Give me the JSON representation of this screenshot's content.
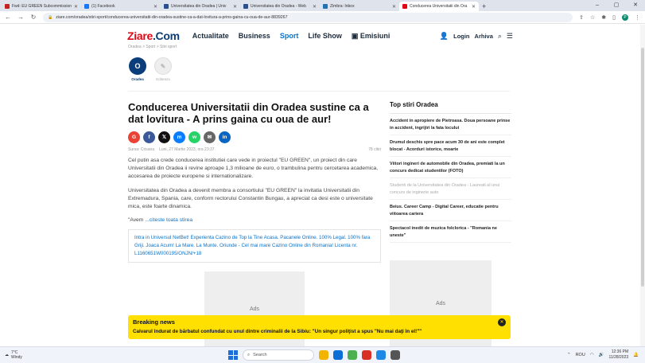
{
  "browser": {
    "tabs": [
      {
        "label": "Fwd: EU GREEN Subcommission",
        "color": "#c5221f",
        "active": false
      },
      {
        "label": "(1) Facebook",
        "color": "#1877f2",
        "active": false
      },
      {
        "label": "Universitatea din Oradea | Univ",
        "color": "#2a4f8f",
        "active": false
      },
      {
        "label": "Universitatea din Oradea - Web",
        "color": "#2a4f8f",
        "active": false
      },
      {
        "label": "Zimbra: Inbox",
        "color": "#1f73b7",
        "active": false
      },
      {
        "label": "Conducerea Universitatii din Ora",
        "color": "#e30613",
        "active": true
      }
    ],
    "new_tab_icon": "+",
    "url": "ziare.com/oradea/stiri-sport/conducerea-universitatii-din-oradea-sustine-ca-a-dat-lovitura-a-prins-gaina-cu-oua-de-aur-8839267",
    "profile_letter": "P"
  },
  "site": {
    "logo_main": "Ziare",
    "logo_suffix": ".Com",
    "nav": [
      "Actualitate",
      "Business",
      "Sport",
      "Life Show",
      "Emisiuni"
    ],
    "active_nav": "Sport",
    "login": "Login",
    "arhiva": "Arhiva",
    "breadcrumb": "Oradea  >  Sport  >  Stiri sport"
  },
  "sources": [
    {
      "initial": "O",
      "label": "Oradea"
    },
    {
      "initial": "✎",
      "label": "Editeaza"
    }
  ],
  "article": {
    "title": "Conducerea Universitatii din Oradea sustine ca a dat lovitura - A prins gaina cu oua de aur!",
    "share": [
      {
        "label": "G",
        "color": "#ea4335"
      },
      {
        "label": "f",
        "color": "#3b5998"
      },
      {
        "label": "𝕏",
        "color": "#111111"
      },
      {
        "label": "m",
        "color": "#0a7cff"
      },
      {
        "label": "w",
        "color": "#25d366"
      },
      {
        "label": "✉",
        "color": "#666666"
      },
      {
        "label": "in",
        "color": "#0a66c2"
      }
    ],
    "source": "Sursa: Crisana",
    "date": "Luni, 27 Martie 2023, ora 23:37",
    "views": "78 citiri",
    "p1": "Cel putin asa crede conducerea institutiei care vede in proiectul \"EU GREEN\", un proiect din care Universitatii din Oradea ii revine aproape 1,3 milioane de euro, o trambulina pentru cercetarea academica, accesarea de proiecte europene si internationalizare.",
    "p2": "Universitatea din Oradea a devenit membra a consortiului \"EU GREEN\" la invitatia Universitatii din Extremadura, Spania, care, conform rectorului Constantin Bungau, a apreciat ca desi este o universitate mica, este foarte dinamica.",
    "quote_start": "\"Avem",
    "read_more": "...citeste toata stirea",
    "ad_text": "Intra in Universul NetBet! Experienta Cazino de Top la Tine Acasa. Pacanele Online. 100% Legal. 100% fara Griji. Joaca Acum! La Mare. La Munte. Oriunde - Cel mai mare Cazino Online din Romania! Licenta nr. L1160651W000195/ONJN/+18",
    "ads_label": "Ads"
  },
  "sidebar": {
    "title": "Top stiri Oradea",
    "items": [
      {
        "text": "Accident in apropiere de Pietroasa. Doua persoane prinse in accident, ingrijiri la fata locului",
        "faded": false
      },
      {
        "text": "Drumul deschis spre pace acum 30 de ani este complet blocat - Acorduri istorice, moarte",
        "faded": false
      },
      {
        "text": "Viitori ingineri de automobile din Oradea, premiati la un concurs dedicat studentilor (FOTO)",
        "faded": false
      },
      {
        "text": "Studenti de la Universitatea din Oradea - Laureati al unui concurs de inginerie auto",
        "faded": true
      },
      {
        "text": "Beius. Career Camp - Digital Career, educatie pentru viitoarea cariera",
        "faded": false
      },
      {
        "text": "Spectacol inedit de muzica folclorica - \"Romania ne uneste\"",
        "faded": false
      }
    ],
    "ads_label": "Ads"
  },
  "breaking": {
    "label": "Breaking news",
    "text": "Calvarul îndurat de bărbatul confundat cu unul dintre criminalii de la Sibiu: \"Un singur poliţist a spus \"Nu mai daţi în el!\"\""
  },
  "taskbar": {
    "temp": "7°C",
    "condition": "Windy",
    "search": "Search",
    "lang": "ROU",
    "time": "12:36 PM",
    "date": "11/28/2023",
    "apps": [
      "#f3b400",
      "#0b6fd6",
      "#4caf50",
      "#d93025",
      "#1e88e5",
      "#555555"
    ]
  }
}
